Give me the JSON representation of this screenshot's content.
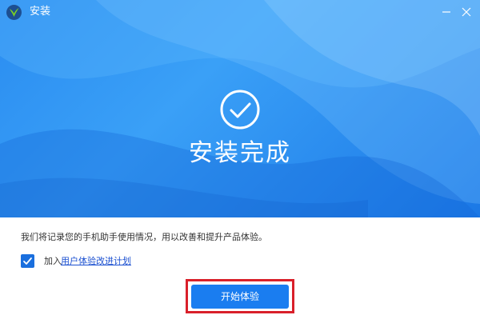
{
  "window": {
    "title": "安装",
    "app_icon": "app-logo-icon",
    "minimize_icon": "minimize-icon",
    "close_icon": "close-icon"
  },
  "banner": {
    "status_icon": "check-circle-icon",
    "heading": "安装完成"
  },
  "body": {
    "notice": "我们将记录您的手机助手使用情况，用以改善和提升产品体验。",
    "join_checkbox_checked": true,
    "join_prefix": "加入",
    "join_link": "用户体验改进计划"
  },
  "actions": {
    "start_label": "开始体验"
  },
  "colors": {
    "banner_blue": "#2a8cf0",
    "button_blue": "#1a7df0",
    "checkbox_blue": "#1a6fde",
    "link_blue": "#1a4fd0",
    "highlight_red": "#d9202a"
  }
}
